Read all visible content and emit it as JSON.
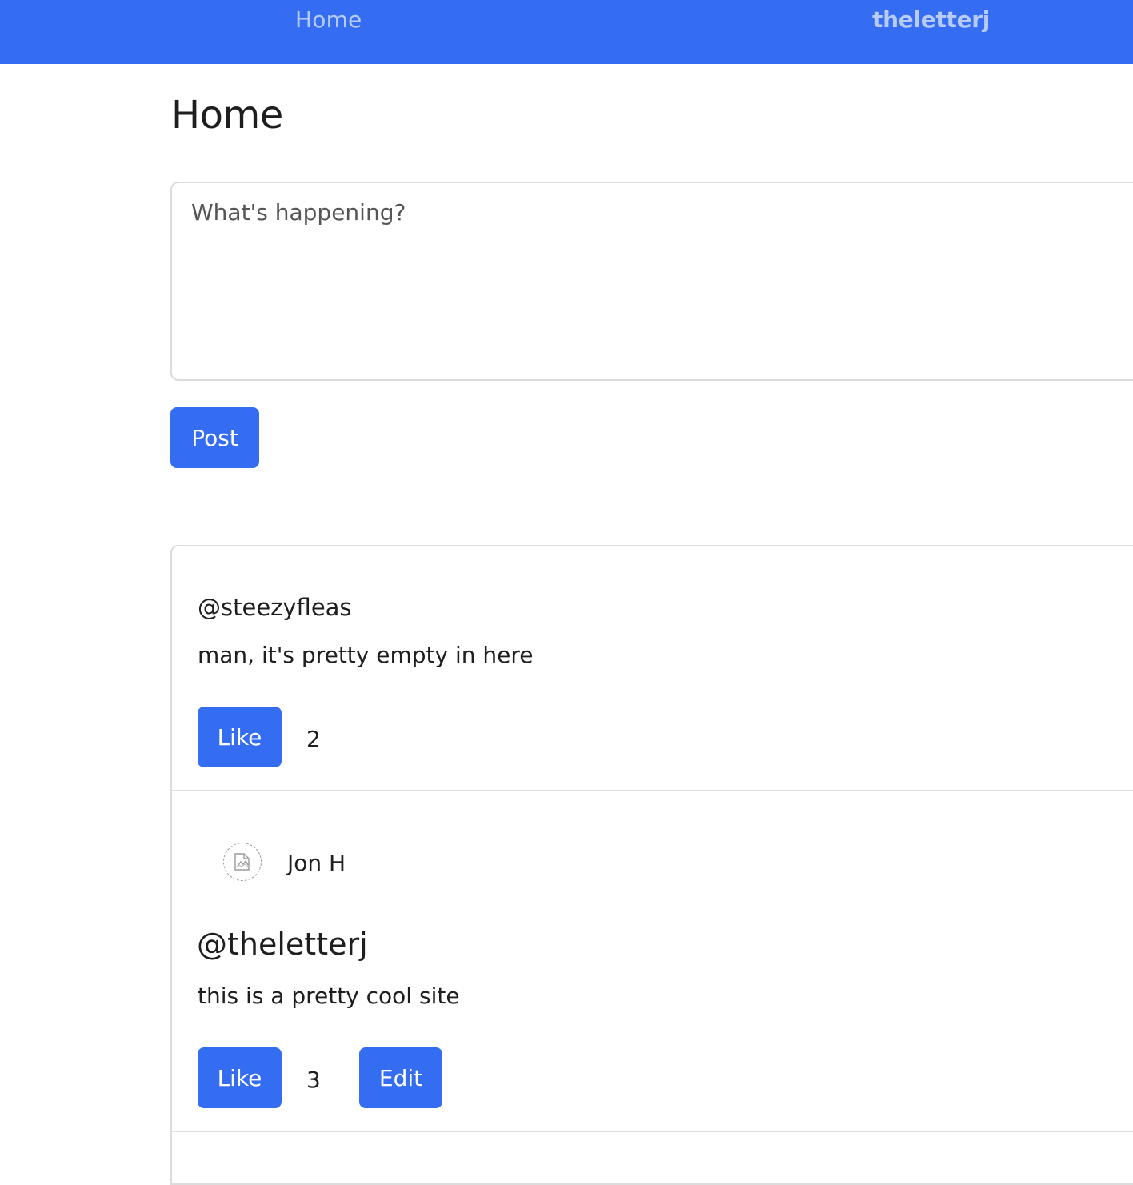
{
  "nav": {
    "home_label": "Home",
    "brand": "theletterj"
  },
  "page": {
    "title": "Home"
  },
  "composer": {
    "placeholder": "What's happening?",
    "value": "",
    "post_label": "Post"
  },
  "posts": [
    {
      "author_name": "",
      "handle": "@steezyfleas",
      "text": "man, it's pretty empty in here",
      "like_label": "Like",
      "likes": "2"
    },
    {
      "author_name": "Jon H",
      "avatar_icon": "broken-image-icon",
      "handle": "@theletterj",
      "text": "this is a pretty cool site",
      "like_label": "Like",
      "likes": "3",
      "edit_label": "Edit"
    }
  ],
  "colors": {
    "primary": "#346df1",
    "nav_text": "#b8cbf7",
    "border": "#dcdcdc"
  }
}
